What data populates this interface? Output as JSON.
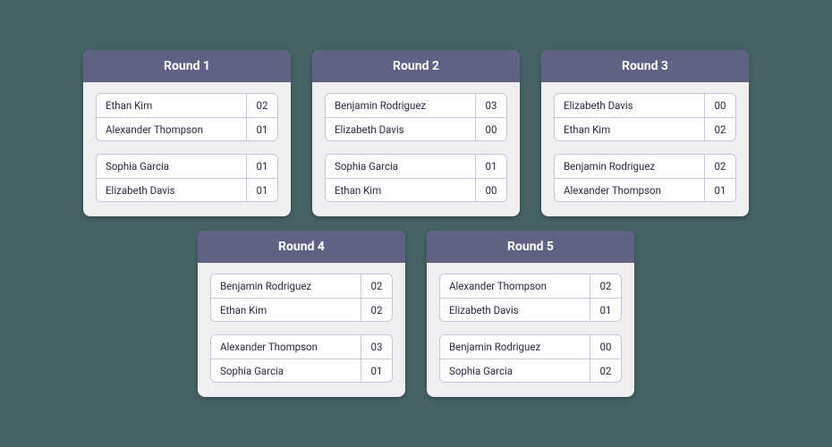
{
  "rounds": [
    {
      "title": "Round 1",
      "matches": [
        {
          "p1": "Ethan Kim",
          "s1": "02",
          "p2": "Alexander Thompson",
          "s2": "01"
        },
        {
          "p1": "Sophia Garcia",
          "s1": "01",
          "p2": "Elizabeth Davis",
          "s2": "01"
        }
      ]
    },
    {
      "title": "Round 2",
      "matches": [
        {
          "p1": "Benjamin Rodriguez",
          "s1": "03",
          "p2": "Elizabeth Davis",
          "s2": "00"
        },
        {
          "p1": "Sophia Garcia",
          "s1": "01",
          "p2": "Ethan Kim",
          "s2": "00"
        }
      ]
    },
    {
      "title": "Round 3",
      "matches": [
        {
          "p1": "Elizabeth Davis",
          "s1": "00",
          "p2": "Ethan Kim",
          "s2": "02"
        },
        {
          "p1": "Benjamin Rodriguez",
          "s1": "02",
          "p2": "Alexander Thompson",
          "s2": "01"
        }
      ]
    },
    {
      "title": "Round 4",
      "matches": [
        {
          "p1": "Benjamin Rodriguez",
          "s1": "02",
          "p2": "Ethan Kim",
          "s2": "02"
        },
        {
          "p1": "Alexander Thompson",
          "s1": "03",
          "p2": "Sophia Garcia",
          "s2": "01"
        }
      ]
    },
    {
      "title": "Round 5",
      "matches": [
        {
          "p1": "Alexander Thompson",
          "s1": "02",
          "p2": "Elizabeth Davis",
          "s2": "01"
        },
        {
          "p1": "Benjamin Rodriguez",
          "s1": "00",
          "p2": "Sophia Garcia",
          "s2": "02"
        }
      ]
    }
  ]
}
